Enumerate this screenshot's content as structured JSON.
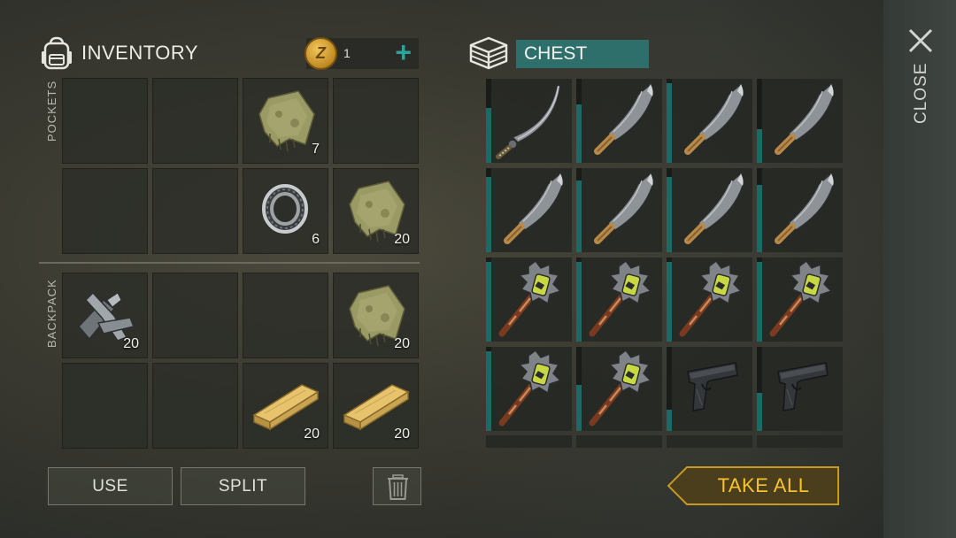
{
  "inventory": {
    "title": "INVENTORY",
    "coins": "1",
    "coin_letter": "Z",
    "pockets_label": "POCKETS",
    "backpack_label": "BACKPACK",
    "pockets_slots": [
      {
        "item": "",
        "qty": ""
      },
      {
        "item": "",
        "qty": ""
      },
      {
        "item": "cloth",
        "qty": "7"
      },
      {
        "item": "",
        "qty": ""
      },
      {
        "item": "",
        "qty": ""
      },
      {
        "item": "",
        "qty": ""
      },
      {
        "item": "bearing",
        "qty": "6"
      },
      {
        "item": "cloth",
        "qty": "20"
      }
    ],
    "backpack_slots": [
      {
        "item": "scrap-metal",
        "qty": "20"
      },
      {
        "item": "",
        "qty": ""
      },
      {
        "item": "",
        "qty": ""
      },
      {
        "item": "cloth",
        "qty": "20"
      },
      {
        "item": "",
        "qty": ""
      },
      {
        "item": "",
        "qty": ""
      },
      {
        "item": "plank",
        "qty": "20"
      },
      {
        "item": "plank",
        "qty": "20"
      }
    ]
  },
  "buttons": {
    "use": "USE",
    "split": "SPLIT",
    "take_all": "TAKE ALL",
    "close": "CLOSE"
  },
  "chest": {
    "title": "CHEST",
    "slots": [
      {
        "item": "katana",
        "durability": 0.65
      },
      {
        "item": "machete",
        "durability": 0.7
      },
      {
        "item": "machete",
        "durability": 0.95
      },
      {
        "item": "machete",
        "durability": 0.4
      },
      {
        "item": "machete",
        "durability": 0.9
      },
      {
        "item": "machete",
        "durability": 0.85
      },
      {
        "item": "machete",
        "durability": 0.9
      },
      {
        "item": "machete",
        "durability": 0.8
      },
      {
        "item": "spiked-bat",
        "durability": 0.95
      },
      {
        "item": "spiked-bat",
        "durability": 0.95
      },
      {
        "item": "spiked-bat",
        "durability": 0.95
      },
      {
        "item": "spiked-bat",
        "durability": 0.95
      },
      {
        "item": "spiked-bat",
        "durability": 0.95
      },
      {
        "item": "spiked-bat",
        "durability": 0.55
      },
      {
        "item": "pistol",
        "durability": 0.25
      },
      {
        "item": "pistol",
        "durability": 0.45
      }
    ]
  },
  "colors": {
    "accent_teal": "#2aa59a",
    "chest_title_bg": "#2e6f6c",
    "take_all_gold": "#f6c232"
  }
}
